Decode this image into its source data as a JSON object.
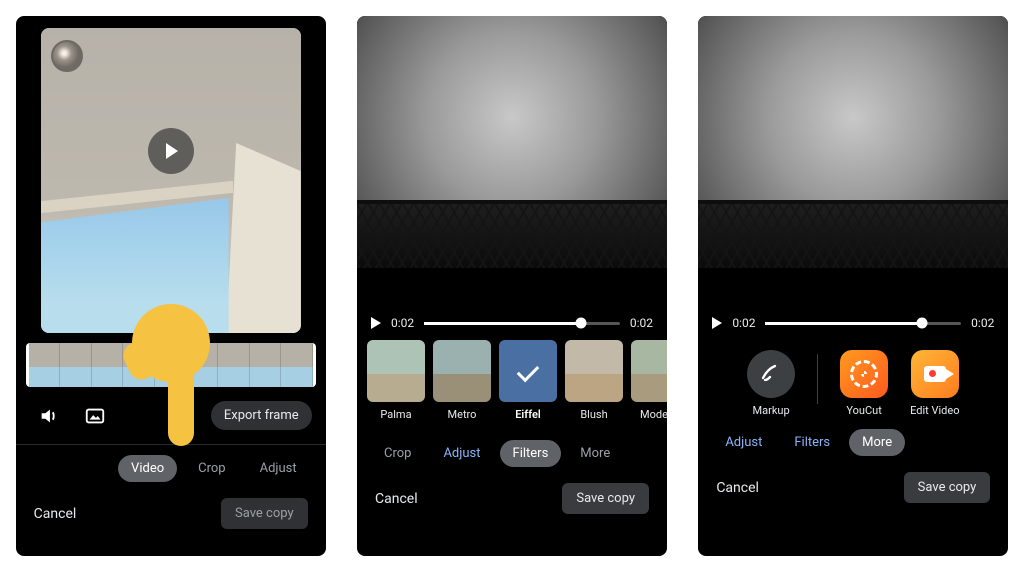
{
  "panel1": {
    "export_label": "Export frame",
    "tabs": {
      "video": "Video",
      "crop": "Crop",
      "adjust": "Adjust"
    },
    "cancel": "Cancel",
    "save": "Save copy",
    "icons": {
      "volume": "volume-icon",
      "stabilize": "stabilize-icon"
    }
  },
  "panel2": {
    "time_start": "0:02",
    "time_end": "0:02",
    "filters": {
      "items": [
        {
          "label": "Palma"
        },
        {
          "label": "Metro"
        },
        {
          "label": "Eiffel"
        },
        {
          "label": "Blush"
        },
        {
          "label": "Modena"
        }
      ]
    },
    "tabs": {
      "crop": "Crop",
      "adjust": "Adjust",
      "filters": "Filters",
      "more": "More"
    },
    "cancel": "Cancel",
    "save": "Save copy"
  },
  "panel3": {
    "time_start": "0:02",
    "time_end": "0:02",
    "apps": {
      "markup": "Markup",
      "youcut": "YouCut",
      "editvideo": "Edit Video"
    },
    "tabs": {
      "adjust": "Adjust",
      "filters": "Filters",
      "more": "More"
    },
    "cancel": "Cancel",
    "save": "Save copy"
  }
}
